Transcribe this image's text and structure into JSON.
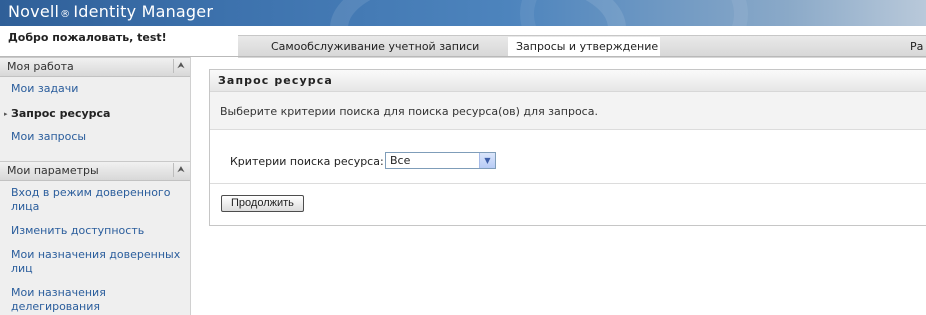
{
  "banner": {
    "brand_left": "Novell",
    "brand_reg": "®",
    "brand_right": "Identity Manager"
  },
  "header": {
    "welcome": "Добро пожаловать, test!",
    "tabs": [
      {
        "label": "Самообслуживание учетной записи",
        "active": false
      },
      {
        "label": "Запросы и утверждение",
        "active": true
      },
      {
        "label": "Ра",
        "active": false
      }
    ]
  },
  "sidebar": {
    "my_work": {
      "title": "Моя работа",
      "items": [
        {
          "label": "Мои задачи"
        },
        {
          "label": "Запрос ресурса",
          "active": true
        },
        {
          "label": "Мои запросы"
        }
      ]
    },
    "my_settings": {
      "title": "Мои параметры",
      "items": [
        {
          "label": "Вход в режим доверенного лица"
        },
        {
          "label": "Изменить доступность"
        },
        {
          "label": "Мои назначения доверенных лиц"
        },
        {
          "label": "Мои назначения делегирования"
        }
      ]
    }
  },
  "main": {
    "title": "Запрос ресурса",
    "intro": "Выберите критерии поиска для поиска ресурса(ов) для запроса.",
    "criteria_label": "Критерии поиска ресурса:",
    "criteria_value": "Все",
    "continue_label": "Продолжить"
  },
  "colors": {
    "link": "#2a5d9c",
    "banner": "#3d72ad"
  }
}
